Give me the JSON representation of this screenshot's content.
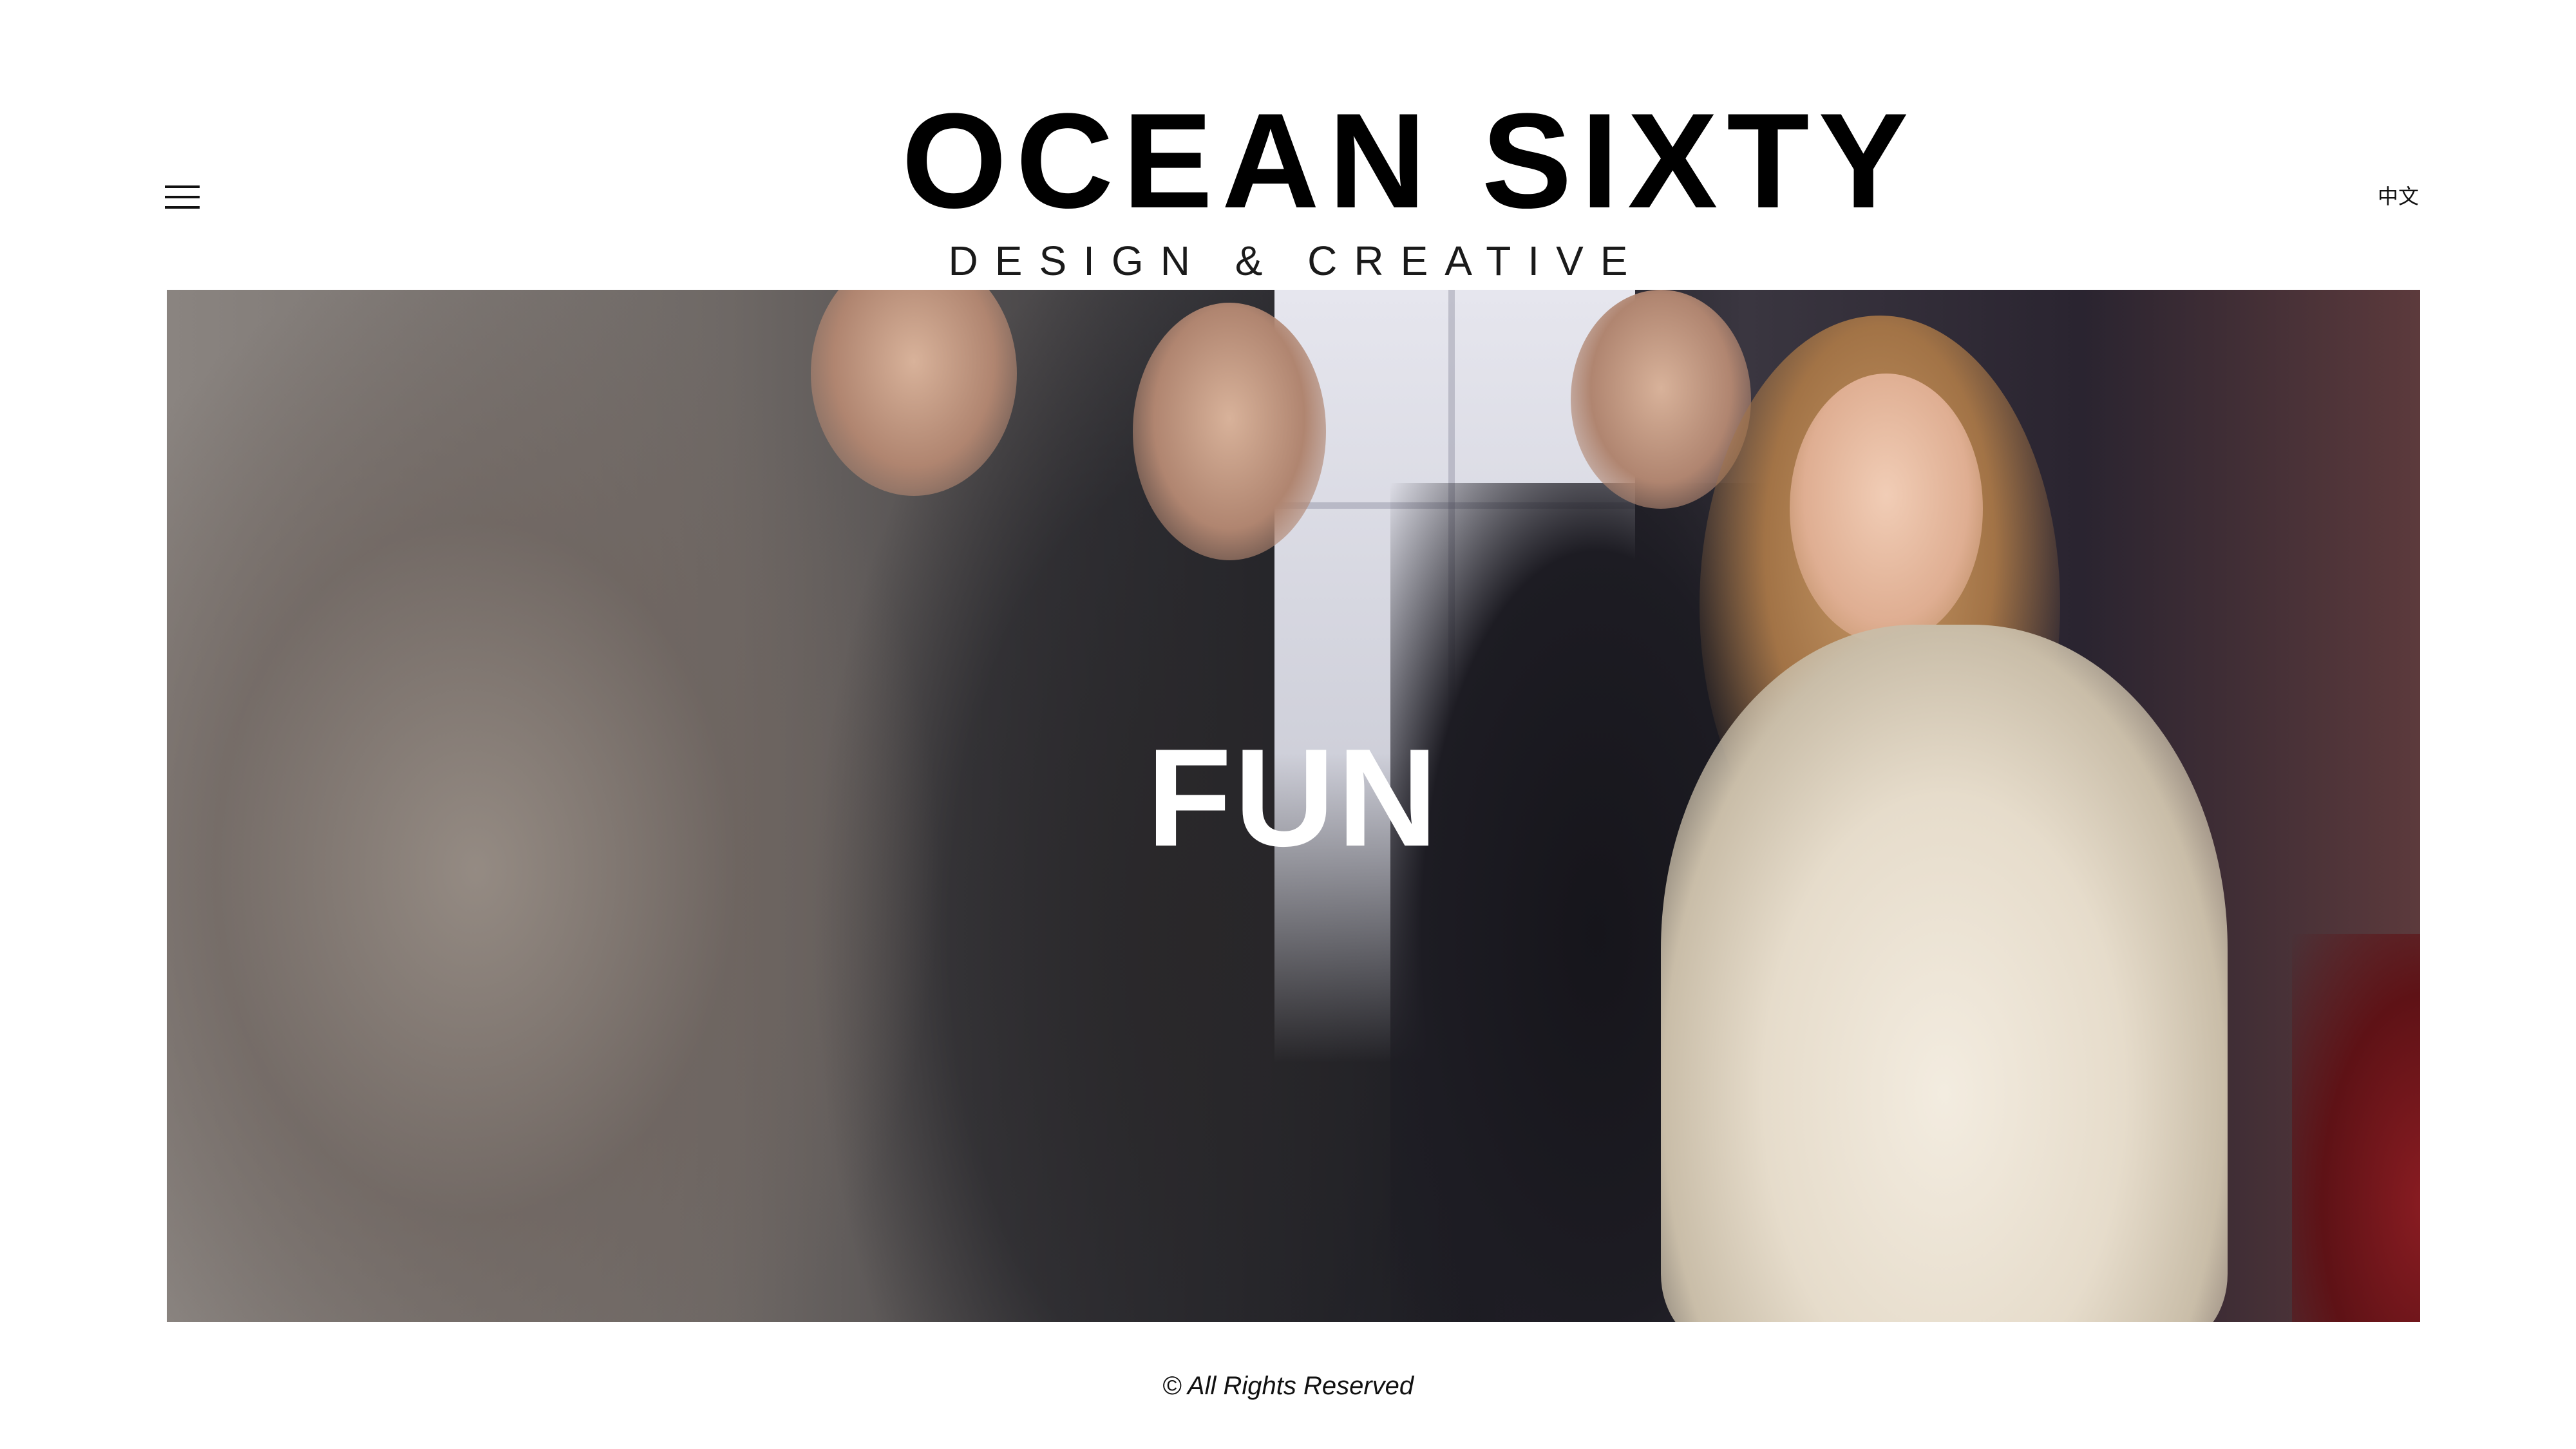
{
  "header": {
    "menu_icon": "hamburger-menu-icon",
    "logo_title": "OCEAN SIXTY",
    "logo_subtitle": "DESIGN & CREATIVE",
    "language_link": "中文"
  },
  "hero": {
    "headline": "FUN",
    "image": "photo-of-smiling-people-at-party-woman-in-white-gown"
  },
  "footer": {
    "copyright": "© All Rights Reserved"
  }
}
